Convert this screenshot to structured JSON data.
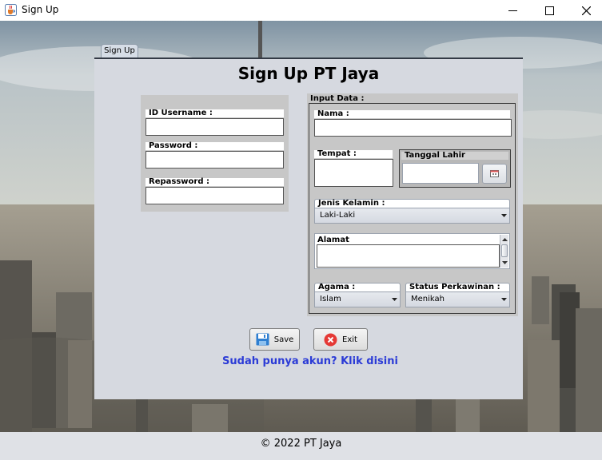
{
  "window": {
    "title": "Sign Up",
    "app_icon": "java-cup-icon",
    "controls": [
      "minimize-icon",
      "maximize-icon",
      "close-icon"
    ]
  },
  "tab": {
    "label": "Sign Up"
  },
  "form": {
    "heading": "Sign Up PT Jaya",
    "account": {
      "username_label": "ID Username :",
      "username_value": "",
      "password_label": "Password :",
      "password_value": "",
      "repassword_label": "Repassword :",
      "repassword_value": ""
    },
    "input_data": {
      "caption": "Input Data :",
      "nama_label": "Nama :",
      "nama_value": "",
      "tempat_label": "Tempat :",
      "tempat_value": "",
      "tanggal_label": "Tanggal Lahir",
      "tanggal_value": "",
      "calendar_icon": "calendar-icon",
      "gender_label": "Jenis Kelamin :",
      "gender_selected": "Laki-Laki",
      "alamat_label": "Alamat",
      "alamat_value": "",
      "agama_label": "Agama :",
      "agama_selected": "Islam",
      "status_label": "Status Perkawinan :",
      "status_selected": "Menikah"
    },
    "buttons": {
      "save_label": "Save",
      "save_icon": "floppy-disk-icon",
      "exit_label": "Exit",
      "exit_icon": "red-x-icon"
    },
    "login_link": "Sudah punya akun? Klik disini"
  },
  "footer": {
    "text": "© 2022 PT Jaya"
  },
  "colors": {
    "panel_bg": "#d6d9e0",
    "card_bg": "#c7c7c7",
    "link": "#2b3bd6",
    "footer_bg": "#dfe1e6"
  }
}
